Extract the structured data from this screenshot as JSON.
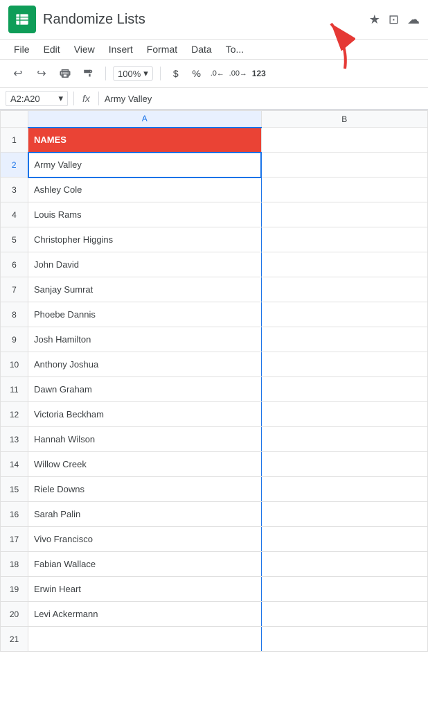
{
  "titleBar": {
    "appName": "Randomize Lists",
    "starIcon": "★",
    "folderIcon": "⊞",
    "cloudIcon": "☁"
  },
  "menuBar": {
    "items": [
      "File",
      "Edit",
      "View",
      "Insert",
      "Format",
      "Data",
      "To"
    ]
  },
  "toolbar": {
    "undoIcon": "↩",
    "redoIcon": "↪",
    "printIcon": "🖨",
    "paintIcon": "🖌",
    "zoom": "100%",
    "zoomDropIcon": "▾",
    "currencyIcon": "$",
    "percentIcon": "%",
    "decimalLeft": ".0",
    "decimalRight": ".00",
    "moreIcon": "123"
  },
  "formulaBar": {
    "cellRef": "A2:A20",
    "dropIcon": "▾",
    "fxLabel": "fx",
    "formula": "Army Valley"
  },
  "columns": {
    "rowNumHeader": "",
    "colA": "A",
    "colB": "B"
  },
  "rows": [
    {
      "rowNum": "1",
      "cellA": "NAMES",
      "cellB": "",
      "isHeader": true
    },
    {
      "rowNum": "2",
      "cellA": "Army Valley",
      "cellB": "",
      "isSelected": true
    },
    {
      "rowNum": "3",
      "cellA": "Ashley Cole",
      "cellB": ""
    },
    {
      "rowNum": "4",
      "cellA": "Louis Rams",
      "cellB": ""
    },
    {
      "rowNum": "5",
      "cellA": "Christopher Higgins",
      "cellB": ""
    },
    {
      "rowNum": "6",
      "cellA": "John David",
      "cellB": ""
    },
    {
      "rowNum": "7",
      "cellA": "Sanjay Sumrat",
      "cellB": ""
    },
    {
      "rowNum": "8",
      "cellA": "Phoebe Dannis",
      "cellB": ""
    },
    {
      "rowNum": "9",
      "cellA": "Josh Hamilton",
      "cellB": ""
    },
    {
      "rowNum": "10",
      "cellA": "Anthony Joshua",
      "cellB": ""
    },
    {
      "rowNum": "11",
      "cellA": "Dawn Graham",
      "cellB": ""
    },
    {
      "rowNum": "12",
      "cellA": "Victoria Beckham",
      "cellB": ""
    },
    {
      "rowNum": "13",
      "cellA": "Hannah Wilson",
      "cellB": ""
    },
    {
      "rowNum": "14",
      "cellA": "Willow Creek",
      "cellB": ""
    },
    {
      "rowNum": "15",
      "cellA": "Riele Downs",
      "cellB": ""
    },
    {
      "rowNum": "16",
      "cellA": "Sarah Palin",
      "cellB": ""
    },
    {
      "rowNum": "17",
      "cellA": "Vivo Francisco",
      "cellB": ""
    },
    {
      "rowNum": "18",
      "cellA": "Fabian Wallace",
      "cellB": ""
    },
    {
      "rowNum": "19",
      "cellA": "Erwin Heart",
      "cellB": ""
    },
    {
      "rowNum": "20",
      "cellA": "Levi Ackermann",
      "cellB": ""
    },
    {
      "rowNum": "21",
      "cellA": "",
      "cellB": ""
    }
  ]
}
